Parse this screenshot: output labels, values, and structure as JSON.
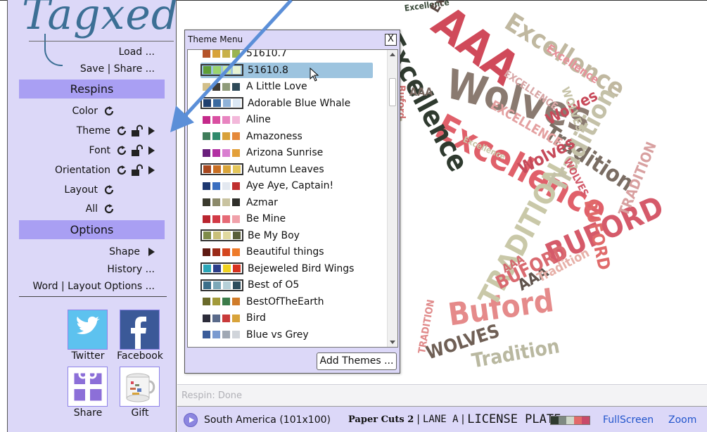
{
  "logo": {
    "text": "Tagxedo"
  },
  "sidebar": {
    "load_label": "Load ...",
    "save_share_label": "Save | Share ...",
    "respins_header": "Respins",
    "respins": [
      {
        "label": "Color",
        "lock": false,
        "play": false
      },
      {
        "label": "Theme",
        "lock": true,
        "play": true
      },
      {
        "label": "Font",
        "lock": true,
        "play": true
      },
      {
        "label": "Orientation",
        "lock": true,
        "play": true
      },
      {
        "label": "Layout",
        "lock": false,
        "play": false
      },
      {
        "label": "All",
        "lock": false,
        "play": false
      }
    ],
    "options_header": "Options",
    "options": {
      "shape_label": "Shape",
      "history_label": "History ...",
      "word_layout_label": "Word | Layout Options ..."
    },
    "social": {
      "twitter_label": "Twitter",
      "facebook_label": "Facebook",
      "share_label": "Share",
      "gift_label": "Gift"
    }
  },
  "theme_menu": {
    "title": "Theme Menu",
    "close_label": "X",
    "add_themes_label": "Add Themes ...",
    "selected_index": 1,
    "items": [
      {
        "name": "51610.7",
        "colors": [
          "#b5542a",
          "#d8a33a",
          "#c8b14a",
          "#9ab451"
        ],
        "bordered": false
      },
      {
        "name": "51610.8",
        "colors": [
          "#5f9e37",
          "#9bd46e",
          "#c9e89a",
          "#e7f3d2"
        ],
        "bordered": true
      },
      {
        "name": "A Little Love",
        "colors": [
          "#d3c08a",
          "#3f3b35",
          "#8f9b7a",
          "#2e4a58"
        ],
        "bordered": false
      },
      {
        "name": "Adorable Blue Whale",
        "colors": [
          "#1f3f6e",
          "#3a6aa0",
          "#8fb2d8",
          "#dbe8f5"
        ],
        "bordered": true
      },
      {
        "name": "Aline",
        "colors": [
          "#c42a8a",
          "#d94fa1",
          "#e884c0",
          "#f3b8da"
        ],
        "bordered": false
      },
      {
        "name": "Amazoness",
        "colors": [
          "#3f7d5a",
          "#2f8a6c",
          "#d8a13a",
          "#e5893a"
        ],
        "bordered": false
      },
      {
        "name": "Arizona Sunrise",
        "colors": [
          "#6a1f7c",
          "#b22fa2",
          "#d97ed0",
          "#e3a03a"
        ],
        "bordered": false
      },
      {
        "name": "Autumn Leaves",
        "colors": [
          "#a8471e",
          "#c96f23",
          "#d9a53a",
          "#e4c65a"
        ],
        "bordered": true
      },
      {
        "name": "Aye Aye, Captain!",
        "colors": [
          "#1d3870",
          "#3a6ec0",
          "#e3e8f0",
          "#c0302f"
        ],
        "bordered": false
      },
      {
        "name": "Azmar",
        "colors": [
          "#3b3b2e",
          "#8c8a6a",
          "#c9c3a0",
          "#2f2f2a"
        ],
        "bordered": false
      },
      {
        "name": "Be Mine",
        "colors": [
          "#b9252f",
          "#d23a46",
          "#e66a76",
          "#f0a1aa"
        ],
        "bordered": false
      },
      {
        "name": "Be My Boy",
        "colors": [
          "#7f8c4a",
          "#c9c07a",
          "#e0d9a0",
          "#5a5f3a"
        ],
        "bordered": true
      },
      {
        "name": "Beautiful things",
        "colors": [
          "#5f1a12",
          "#9b2a17",
          "#d4461f",
          "#ee7b2a"
        ],
        "bordered": false
      },
      {
        "name": "Bejeweled Bird Wings",
        "colors": [
          "#2aa6b8",
          "#2b3e8a",
          "#f0d21f",
          "#d8321f"
        ],
        "bordered": true
      },
      {
        "name": "Best of O5",
        "colors": [
          "#3c6f8a",
          "#7da8b8",
          "#b6d0d8",
          "#2e4e5e"
        ],
        "bordered": true
      },
      {
        "name": "BestOfTheEarth",
        "colors": [
          "#6a6a2a",
          "#a29a3a",
          "#3c7c4a",
          "#d07c2a"
        ],
        "bordered": false
      },
      {
        "name": "Bird",
        "colors": [
          "#2c2c3a",
          "#5a6a8a",
          "#c83a3a",
          "#d8a33a"
        ],
        "bordered": false
      },
      {
        "name": "Blue vs Grey",
        "colors": [
          "#3a5c9a",
          "#7a9ad0",
          "#a0a8b4",
          "#d0d4da"
        ],
        "bordered": false
      }
    ]
  },
  "status": {
    "text": "Respin: Done"
  },
  "bottom_bar": {
    "shape_label": "South America (101x100)",
    "font1": "Paper Cuts 2",
    "font2": "LANE A",
    "font3": "LICENSE PLATE",
    "separator": "|",
    "swatch_colors": [
      "#2f3b2f",
      "#7f8a82",
      "#cfd8c9",
      "#e26a6a",
      "#c84a6a"
    ],
    "fullscreen_label": "FullScreen",
    "zoom_label": "Zoom"
  },
  "cloud_words": [
    {
      "text": "AAA",
      "color": "#d04a5a"
    },
    {
      "text": "Wolves",
      "color": "#8a7a70"
    },
    {
      "text": "Excellence",
      "color": "#e0606a"
    },
    {
      "text": "Excellence",
      "color": "#2f3a2f"
    },
    {
      "text": "Excellence",
      "color": "#c0b8a0"
    },
    {
      "text": "Tradition",
      "color": "#7a6d63"
    },
    {
      "text": "BUFORD",
      "color": "#d55a6a"
    },
    {
      "text": "Buford",
      "color": "#e58a8a"
    },
    {
      "text": "TRADITION",
      "color": "#c9c8a8"
    },
    {
      "text": "WOLVES",
      "color": "#6f5f55"
    },
    {
      "text": "Tradition",
      "color": "#b9b8a0"
    },
    {
      "text": "AAA",
      "color": "#b8b09a"
    },
    {
      "text": "Wolves",
      "color": "#c84a5a"
    },
    {
      "text": "TRADITION",
      "color": "#d8a0a0"
    },
    {
      "text": "BUFORD",
      "color": "#e06a6a"
    },
    {
      "text": "EXCELLENCE",
      "color": "#e4a0a0"
    },
    {
      "text": "Excellence",
      "color": "#e8909a"
    },
    {
      "text": "AAA",
      "color": "#7a6a62"
    },
    {
      "text": "Excellence",
      "color": "#3a4a3a"
    },
    {
      "text": "Tradition",
      "color": "#c4c1a8"
    },
    {
      "text": "WOLVES",
      "color": "#c6c3a8"
    },
    {
      "text": "Excellence",
      "color": "#5a4a44"
    },
    {
      "text": "EXCELLENCE",
      "color": "#d8a6a6"
    },
    {
      "text": "AAA",
      "color": "#5f534c"
    },
    {
      "text": "Wolves",
      "color": "#c64a5a"
    },
    {
      "text": "BUFORD",
      "color": "#d96a70"
    },
    {
      "text": "Tradition",
      "color": "#e7b0a8"
    },
    {
      "text": "WOLVES",
      "color": "#d25a6a"
    },
    {
      "text": "Buford",
      "color": "#d07070"
    },
    {
      "text": "TRADITION",
      "color": "#e08a8a"
    },
    {
      "text": "Excellence",
      "color": "#c9c6a8"
    },
    {
      "text": "AAA",
      "color": "#d46a70"
    }
  ]
}
